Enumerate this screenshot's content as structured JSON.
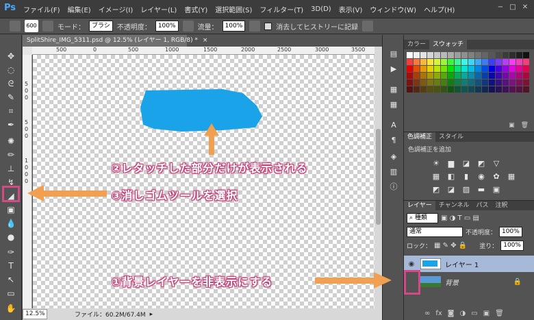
{
  "app": {
    "logo": "Ps"
  },
  "menu": [
    "ファイル(F)",
    "編集(E)",
    "イメージ(I)",
    "レイヤー(L)",
    "書式(Y)",
    "選択範囲(S)",
    "フィルター(T)",
    "3D(D)",
    "表示(V)",
    "ウィンドウ(W)",
    "ヘルプ(H)"
  ],
  "window_controls": {
    "minimize": "−",
    "maximize": "□",
    "close": "✕"
  },
  "options_bar": {
    "brush_size": "600",
    "mode_label": "モード：",
    "mode_value": "ブラシ",
    "opacity_label": "不透明度：",
    "opacity_value": "100%",
    "flow_label": "流量：",
    "flow_value": "100%",
    "history_label": "消去してヒストリーに記録"
  },
  "document": {
    "tab_title": "SplitShire_IMG_5311.psd @ 12.5% (レイヤー 1, RGB/8) *",
    "tab_close": "×",
    "ruler_top_ticks": [
      "500",
      "0",
      "500",
      "1000",
      "1500",
      "2000",
      "2500",
      "3000",
      "3500"
    ],
    "ruler_left_ticks": [
      "5",
      "0",
      "0",
      "5",
      "0",
      "0",
      "1",
      "0",
      "0",
      "0"
    ],
    "blob_color": "#1aa3e8"
  },
  "status": {
    "zoom": "12.5%",
    "file_info": "ファイル：60.2M/67.4M"
  },
  "annotations": {
    "step1": "①背景レイヤーを非表示にする",
    "step2": "②レタッチした部分だけが表示される",
    "step3": "③消しゴムツールを選択",
    "accent_color": "#f0a050",
    "highlight_color": "#d34a86"
  },
  "color_panel": {
    "tab_color": "カラー",
    "tab_swatches": "スウォッチ"
  },
  "adjust_panel": {
    "tab_adjust": "色調補正",
    "tab_style": "スタイル",
    "add_label": "色調補正を追加"
  },
  "layers_panel": {
    "tab_layers": "レイヤー",
    "tab_channels": "チャンネル",
    "tab_paths": "パス",
    "tab_history": "注釈",
    "filter_label": "種類",
    "blend_mode": "通常",
    "opacity_label": "不透明度：",
    "opacity_value": "100%",
    "lock_label": "ロック：",
    "fill_label": "塗り：",
    "fill_value": "100%",
    "layers": [
      {
        "name": "レイヤー 1"
      },
      {
        "name": "背景"
      }
    ]
  }
}
